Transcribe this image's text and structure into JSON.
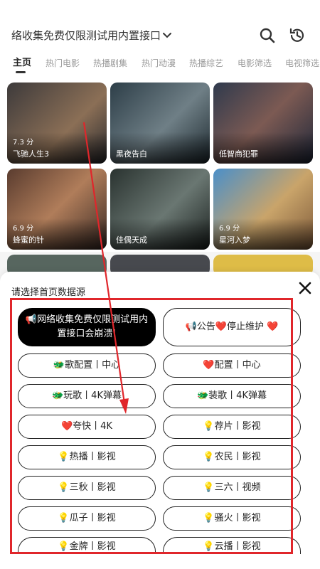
{
  "header": {
    "title": "络收集免费仅限测试用内置接口会",
    "title_icon": "chevron-down-icon",
    "search_icon": "search-icon",
    "history_icon": "history-icon"
  },
  "tabs": [
    {
      "label": "主页",
      "active": true
    },
    {
      "label": "热门电影"
    },
    {
      "label": "热播剧集"
    },
    {
      "label": "热门动漫"
    },
    {
      "label": "热播综艺"
    },
    {
      "label": "电影筛选"
    },
    {
      "label": "电视筛选"
    }
  ],
  "cards": [
    {
      "name": "飞驰人生3",
      "score": "7.3 分"
    },
    {
      "name": "黑夜告白",
      "score": ""
    },
    {
      "name": "低智商犯罪",
      "score": ""
    },
    {
      "name": "蜂蜜的针",
      "score": "6.9 分"
    },
    {
      "name": "佳偶天成",
      "score": ""
    },
    {
      "name": "星河入梦",
      "score": "6.9 分"
    }
  ],
  "sheet": {
    "title": "请选择首页数据源",
    "close_icon": "close-icon",
    "sources": [
      {
        "label": "📢网络收集免费仅限测试用内置接口会崩溃!",
        "selected": true
      },
      {
        "label": "📢公告❤️停止维护 ❤️"
      },
      {
        "label": "🐲歌配置丨中心"
      },
      {
        "label": "❤️配置丨中心"
      },
      {
        "label": "🐲玩歌丨4K弹幕"
      },
      {
        "label": "🐲装歌丨4K弹幕"
      },
      {
        "label": "❤️夸快丨4K"
      },
      {
        "label": "💡荐片丨影视"
      },
      {
        "label": "💡热播丨影视"
      },
      {
        "label": "💡农民丨影视"
      },
      {
        "label": "💡三秋丨影视"
      },
      {
        "label": "💡三六丨视频"
      },
      {
        "label": "💡瓜子丨影视"
      },
      {
        "label": "💡骚火丨影视"
      },
      {
        "label": "💡金牌丨影视"
      },
      {
        "label": "💡云播丨影视"
      }
    ]
  },
  "colors": {
    "annotation_red": "#e0262b",
    "selected_bg": "#000000"
  }
}
